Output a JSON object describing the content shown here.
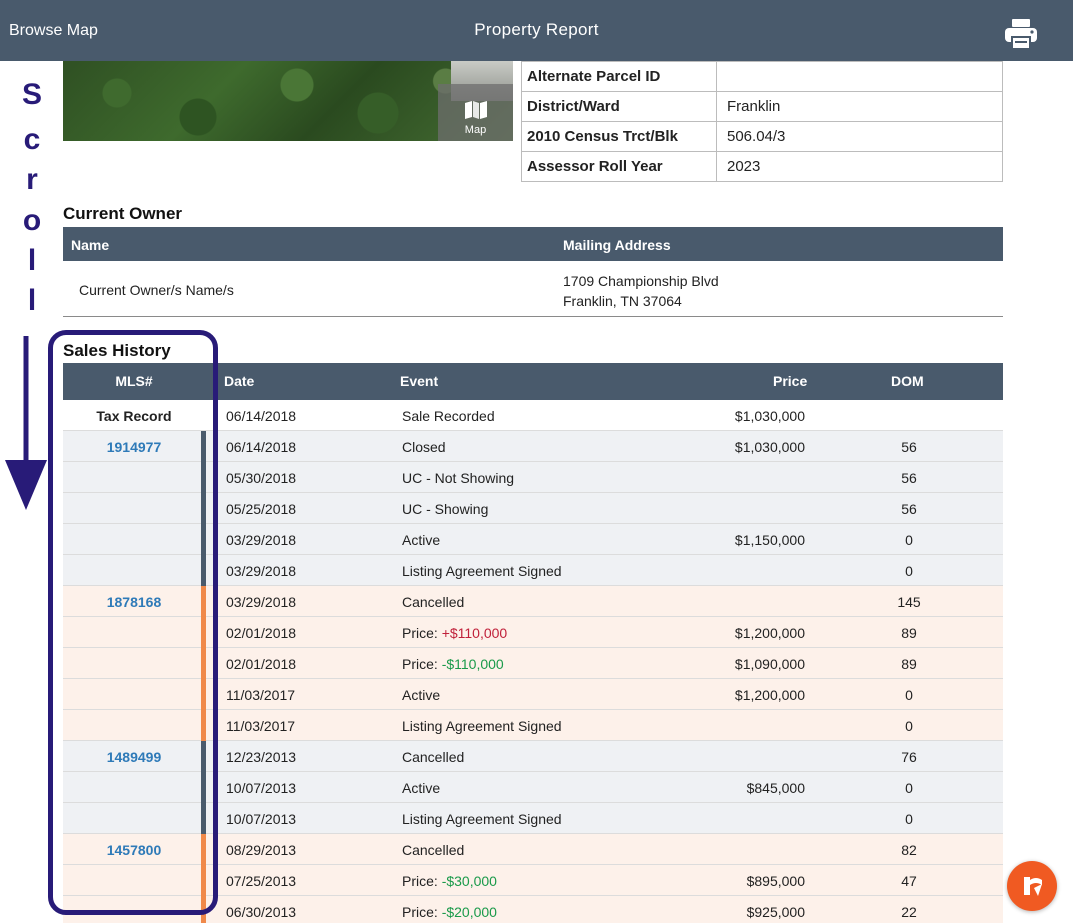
{
  "header": {
    "back_label": "Browse Map",
    "title": "Property Report"
  },
  "map_button": {
    "label": "Map"
  },
  "parcel_info": [
    {
      "label": "Alternate Parcel ID",
      "value": ""
    },
    {
      "label": "District/Ward",
      "value": "Franklin"
    },
    {
      "label": "2010 Census Trct/Blk",
      "value": "506.04/3"
    },
    {
      "label": "Assessor Roll Year",
      "value": "2023"
    }
  ],
  "annotation": {
    "letters": [
      "S",
      "c",
      "r",
      "o",
      "l",
      "l"
    ],
    "color": "#281b78"
  },
  "current_owner": {
    "title": "Current Owner",
    "columns": {
      "name": "Name",
      "address": "Mailing Address"
    },
    "row": {
      "name": "Current Owner/s Name/s",
      "address_line1": "1709 Championship Blvd",
      "address_line2": "Franklin, TN 37064"
    }
  },
  "sales_history": {
    "title": "Sales History",
    "columns": {
      "mls": "MLS#",
      "date": "Date",
      "event": "Event",
      "price": "Price",
      "dom": "DOM"
    },
    "colors": {
      "header": "#495a6c",
      "grey_bar": "#495a6c",
      "orange_bar": "#f0894a",
      "link": "#2e7ab8"
    },
    "rows": [
      {
        "group": "tax",
        "mls": "Tax Record",
        "date": "06/14/2018",
        "event": "Sale Recorded",
        "change": "",
        "dir": "",
        "price": "$1,030,000",
        "dom": ""
      },
      {
        "group": "grey",
        "mls": "1914977",
        "date": "06/14/2018",
        "event": "Closed",
        "change": "",
        "dir": "",
        "price": "$1,030,000",
        "dom": "56"
      },
      {
        "group": "grey",
        "mls": "",
        "date": "05/30/2018",
        "event": "UC - Not Showing",
        "change": "",
        "dir": "",
        "price": "",
        "dom": "56"
      },
      {
        "group": "grey",
        "mls": "",
        "date": "05/25/2018",
        "event": "UC - Showing",
        "change": "",
        "dir": "",
        "price": "",
        "dom": "56"
      },
      {
        "group": "grey",
        "mls": "",
        "date": "03/29/2018",
        "event": "Active",
        "change": "",
        "dir": "",
        "price": "$1,150,000",
        "dom": "0"
      },
      {
        "group": "grey",
        "mls": "",
        "date": "03/29/2018",
        "event": "Listing Agreement Signed",
        "change": "",
        "dir": "",
        "price": "",
        "dom": "0"
      },
      {
        "group": "peach",
        "mls": "1878168",
        "date": "03/29/2018",
        "event": "Cancelled",
        "change": "",
        "dir": "",
        "price": "",
        "dom": "145"
      },
      {
        "group": "peach",
        "mls": "",
        "date": "02/01/2018",
        "event": "Price: ",
        "change": "+$110,000",
        "dir": "up",
        "price": "$1,200,000",
        "dom": "89"
      },
      {
        "group": "peach",
        "mls": "",
        "date": "02/01/2018",
        "event": "Price: ",
        "change": "-$110,000",
        "dir": "down",
        "price": "$1,090,000",
        "dom": "89"
      },
      {
        "group": "peach",
        "mls": "",
        "date": "11/03/2017",
        "event": "Active",
        "change": "",
        "dir": "",
        "price": "$1,200,000",
        "dom": "0"
      },
      {
        "group": "peach",
        "mls": "",
        "date": "11/03/2017",
        "event": "Listing Agreement Signed",
        "change": "",
        "dir": "",
        "price": "",
        "dom": "0"
      },
      {
        "group": "grey",
        "mls": "1489499",
        "date": "12/23/2013",
        "event": "Cancelled",
        "change": "",
        "dir": "",
        "price": "",
        "dom": "76"
      },
      {
        "group": "grey",
        "mls": "",
        "date": "10/07/2013",
        "event": "Active",
        "change": "",
        "dir": "",
        "price": "$845,000",
        "dom": "0"
      },
      {
        "group": "grey",
        "mls": "",
        "date": "10/07/2013",
        "event": "Listing Agreement Signed",
        "change": "",
        "dir": "",
        "price": "",
        "dom": "0"
      },
      {
        "group": "peach",
        "mls": "1457800",
        "date": "08/29/2013",
        "event": "Cancelled",
        "change": "",
        "dir": "",
        "price": "",
        "dom": "82"
      },
      {
        "group": "peach",
        "mls": "",
        "date": "07/25/2013",
        "event": "Price: ",
        "change": "-$30,000",
        "dir": "down",
        "price": "$895,000",
        "dom": "47"
      },
      {
        "group": "peach",
        "mls": "",
        "date": "06/30/2013",
        "event": "Price: ",
        "change": "-$20,000",
        "dir": "down",
        "price": "$925,000",
        "dom": "22"
      }
    ]
  },
  "icons": {
    "print": "printer-icon",
    "map": "map-icon",
    "logo": "brand-logo-icon"
  }
}
